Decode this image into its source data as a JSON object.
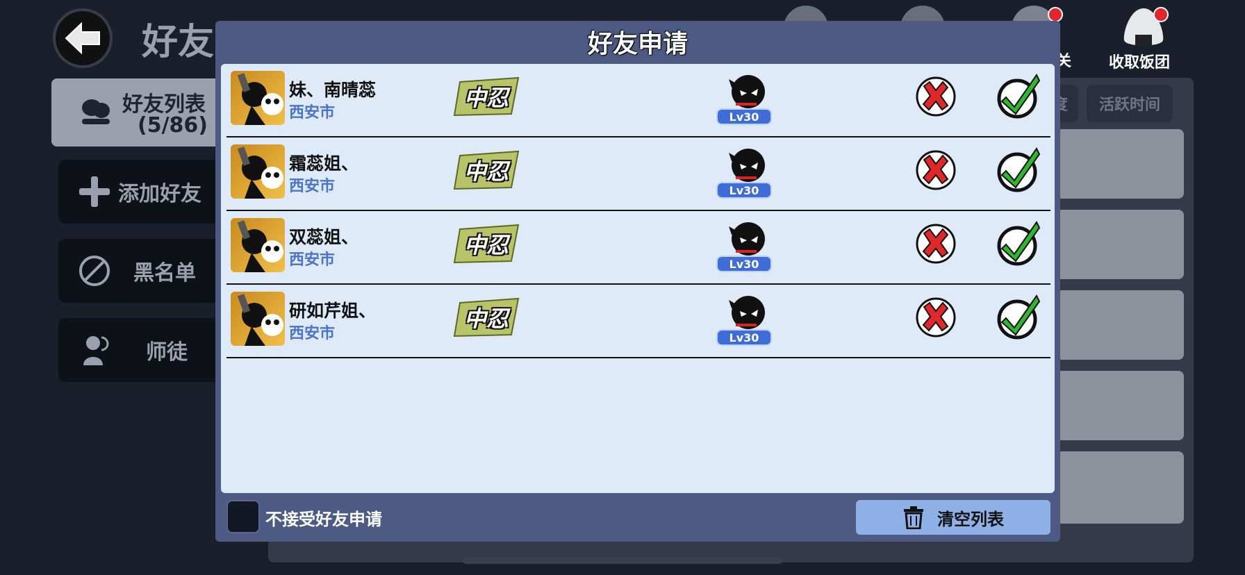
{
  "background": {
    "title": "好友",
    "sidebar": {
      "friend_list_label": "好友列表",
      "friend_list_count": "(5/86)",
      "add_friend": "添加好友",
      "blacklist": "黑名单",
      "mentor": "师徒"
    },
    "tabs": [
      "度",
      "活跃时间"
    ],
    "top_right_label": "收取饭团",
    "top_partial_label": "关"
  },
  "modal": {
    "title": "好友申请",
    "requests": [
      {
        "name": "妹、南晴蕊",
        "city": "西安市",
        "rank_text": "中忍",
        "level": "Lv30"
      },
      {
        "name": "霜蕊姐、",
        "city": "西安市",
        "rank_text": "中忍",
        "level": "Lv30"
      },
      {
        "name": "双蕊姐、",
        "city": "西安市",
        "rank_text": "中忍",
        "level": "Lv30"
      },
      {
        "name": "研如芹姐、",
        "city": "西安市",
        "rank_text": "中忍",
        "level": "Lv30"
      }
    ],
    "reject_requests_label": "不接受好友申请",
    "clear_list_label": "清空列表"
  },
  "colors": {
    "modal_bg": "#4d5a84",
    "list_bg": "#dfeaf8",
    "city_text": "#4a73c9",
    "level_badge": "#3f6cd6",
    "accept_green": "#2db82d",
    "reject_red": "#e0282a",
    "clear_button": "#8fb0e6"
  },
  "icons": [
    "back-arrow-icon",
    "rice-ball-icon",
    "plus-icon",
    "ban-icon",
    "people-icon",
    "ninja-icon",
    "reject-x-icon",
    "accept-check-icon",
    "trash-icon"
  ]
}
